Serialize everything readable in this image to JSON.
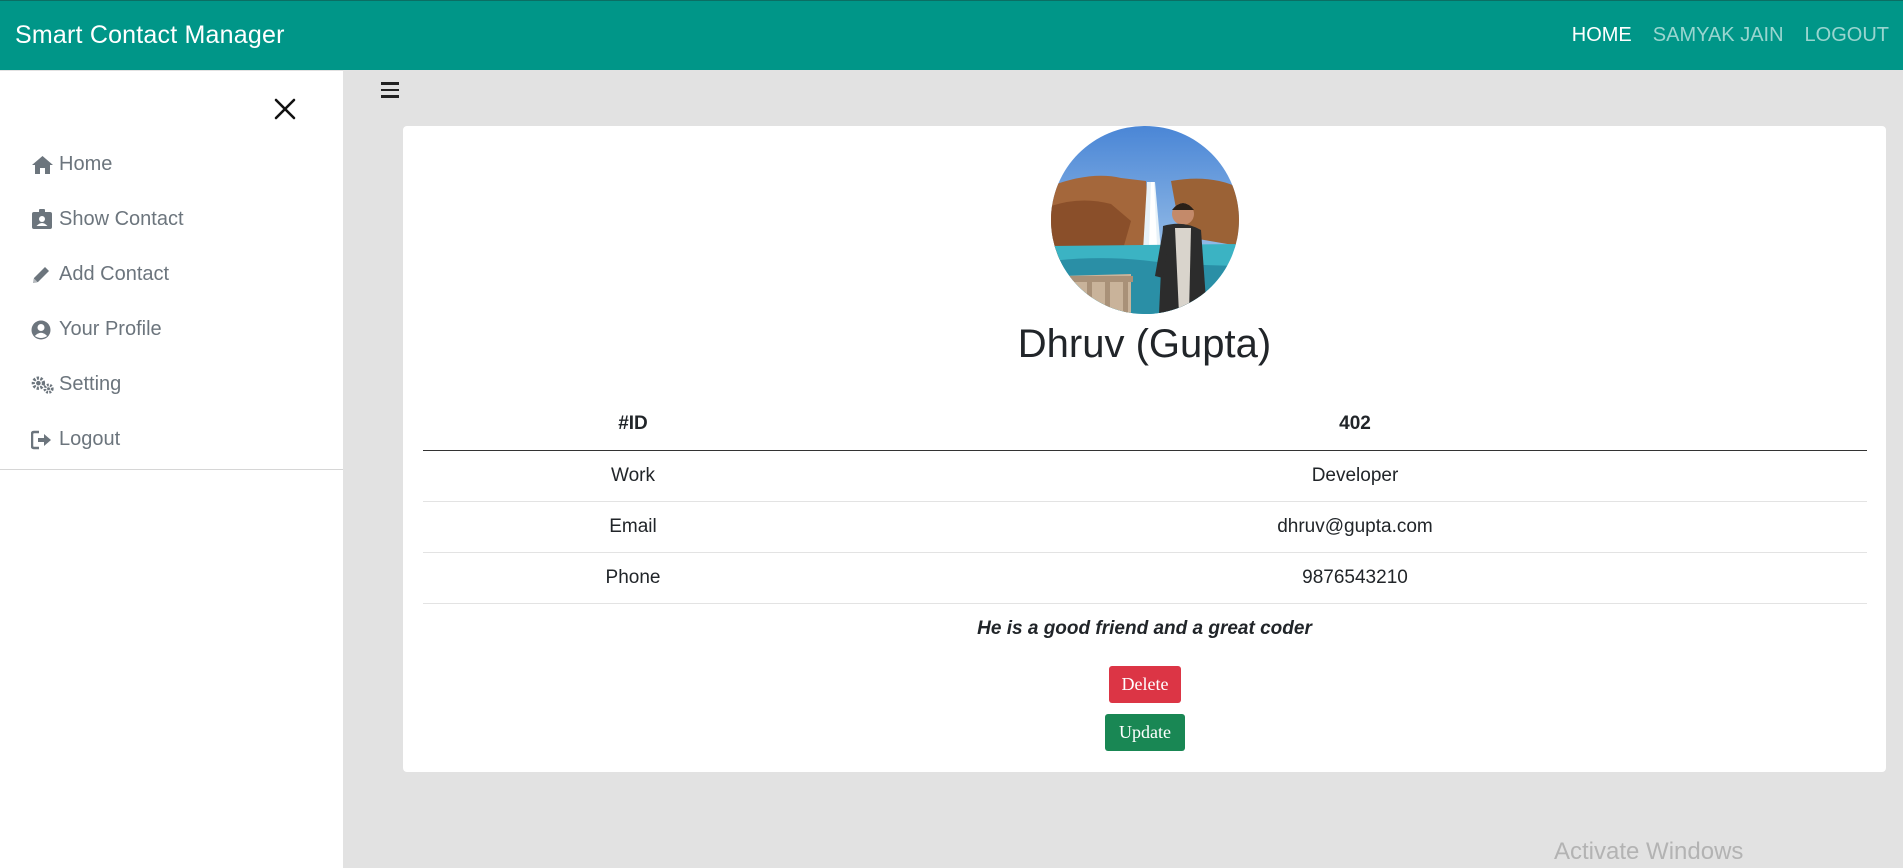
{
  "navbar": {
    "brand": "Smart Contact Manager",
    "links": [
      "HOME",
      "SAMYAK JAIN",
      "LOGOUT"
    ],
    "bg_color": "#009688"
  },
  "sidebar": {
    "items": [
      {
        "icon": "home-icon",
        "label": "Home"
      },
      {
        "icon": "id-card-icon",
        "label": "Show Contact"
      },
      {
        "icon": "pencil-icon",
        "label": "Add Contact"
      },
      {
        "icon": "user-circle-icon",
        "label": "Your Profile"
      },
      {
        "icon": "gears-icon",
        "label": "Setting"
      },
      {
        "icon": "sign-out-icon",
        "label": "Logout"
      }
    ]
  },
  "contact": {
    "name": "Dhruv (Gupta)",
    "table": {
      "header": [
        "#ID",
        "402"
      ],
      "rows": [
        [
          "Work",
          "Developer"
        ],
        [
          "Email",
          "dhruv@gupta.com"
        ],
        [
          "Phone",
          "9876543210"
        ]
      ]
    },
    "description": "He is a good friend and a great coder",
    "delete_label": "Delete",
    "update_label": "Update"
  },
  "watermark": "Activate Windows",
  "colors": {
    "delete": "#dc3545",
    "update": "#198754",
    "background": "#e2e2e2"
  }
}
